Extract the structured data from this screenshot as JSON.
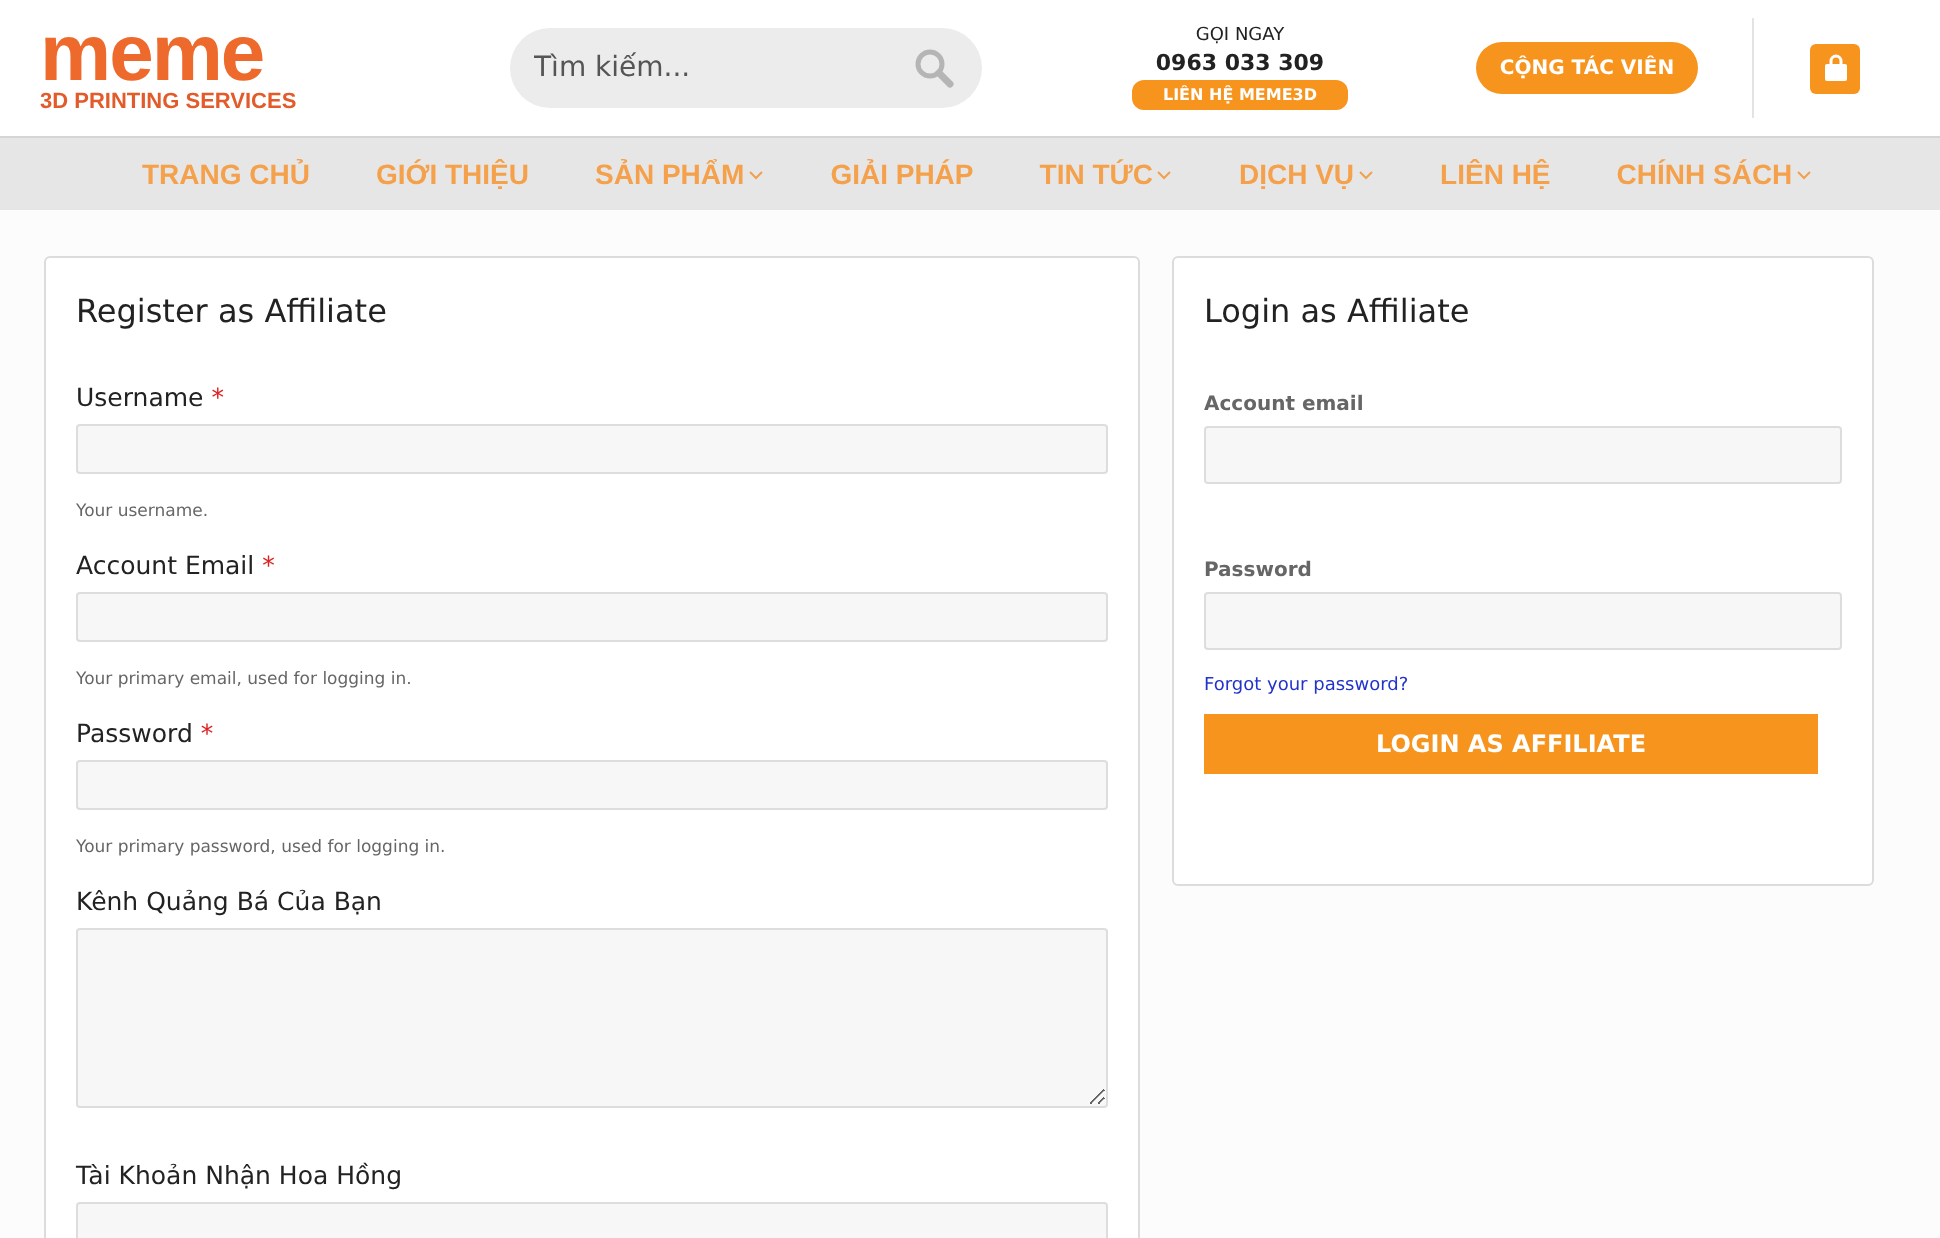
{
  "header": {
    "logo": {
      "word": "meme",
      "tagline": "3D PRINTING SERVICES"
    },
    "search": {
      "placeholder": "Tìm kiếm..."
    },
    "hotline": {
      "label": "GỌI NGAY",
      "phone": "0963 033 309",
      "button": "LIÊN HỆ MEME3D"
    },
    "affiliate_button": "CỘNG TÁC VIÊN"
  },
  "nav": [
    {
      "label": "TRANG CHỦ",
      "has_dropdown": false
    },
    {
      "label": "GIỚI THIỆU",
      "has_dropdown": false
    },
    {
      "label": "SẢN PHẨM",
      "has_dropdown": true
    },
    {
      "label": "GIẢI PHÁP",
      "has_dropdown": false
    },
    {
      "label": "TIN TỨC",
      "has_dropdown": true
    },
    {
      "label": "DỊCH VỤ",
      "has_dropdown": true
    },
    {
      "label": "LIÊN HỆ",
      "has_dropdown": false
    },
    {
      "label": "CHÍNH SÁCH",
      "has_dropdown": true
    }
  ],
  "register": {
    "title": "Register as Affiliate",
    "required_mark": "*",
    "fields": [
      {
        "kind": "input",
        "label": "Username",
        "required": true,
        "hint": "Your username."
      },
      {
        "kind": "input",
        "label": "Account Email",
        "required": true,
        "hint": "Your primary email, used for logging in."
      },
      {
        "kind": "input",
        "label": "Password",
        "required": true,
        "hint": "Your primary password, used for logging in."
      },
      {
        "kind": "textarea",
        "label": "Kênh Quảng Bá Của Bạn",
        "required": false
      },
      {
        "kind": "input",
        "label": "Tài Khoản Nhận Hoa Hồng",
        "required": false
      }
    ]
  },
  "login": {
    "title": "Login as Affiliate",
    "fields": [
      {
        "label": "Account email"
      },
      {
        "label": "Password"
      }
    ],
    "forgot_link": "Forgot your password?",
    "button": "LOGIN AS AFFILIATE"
  }
}
